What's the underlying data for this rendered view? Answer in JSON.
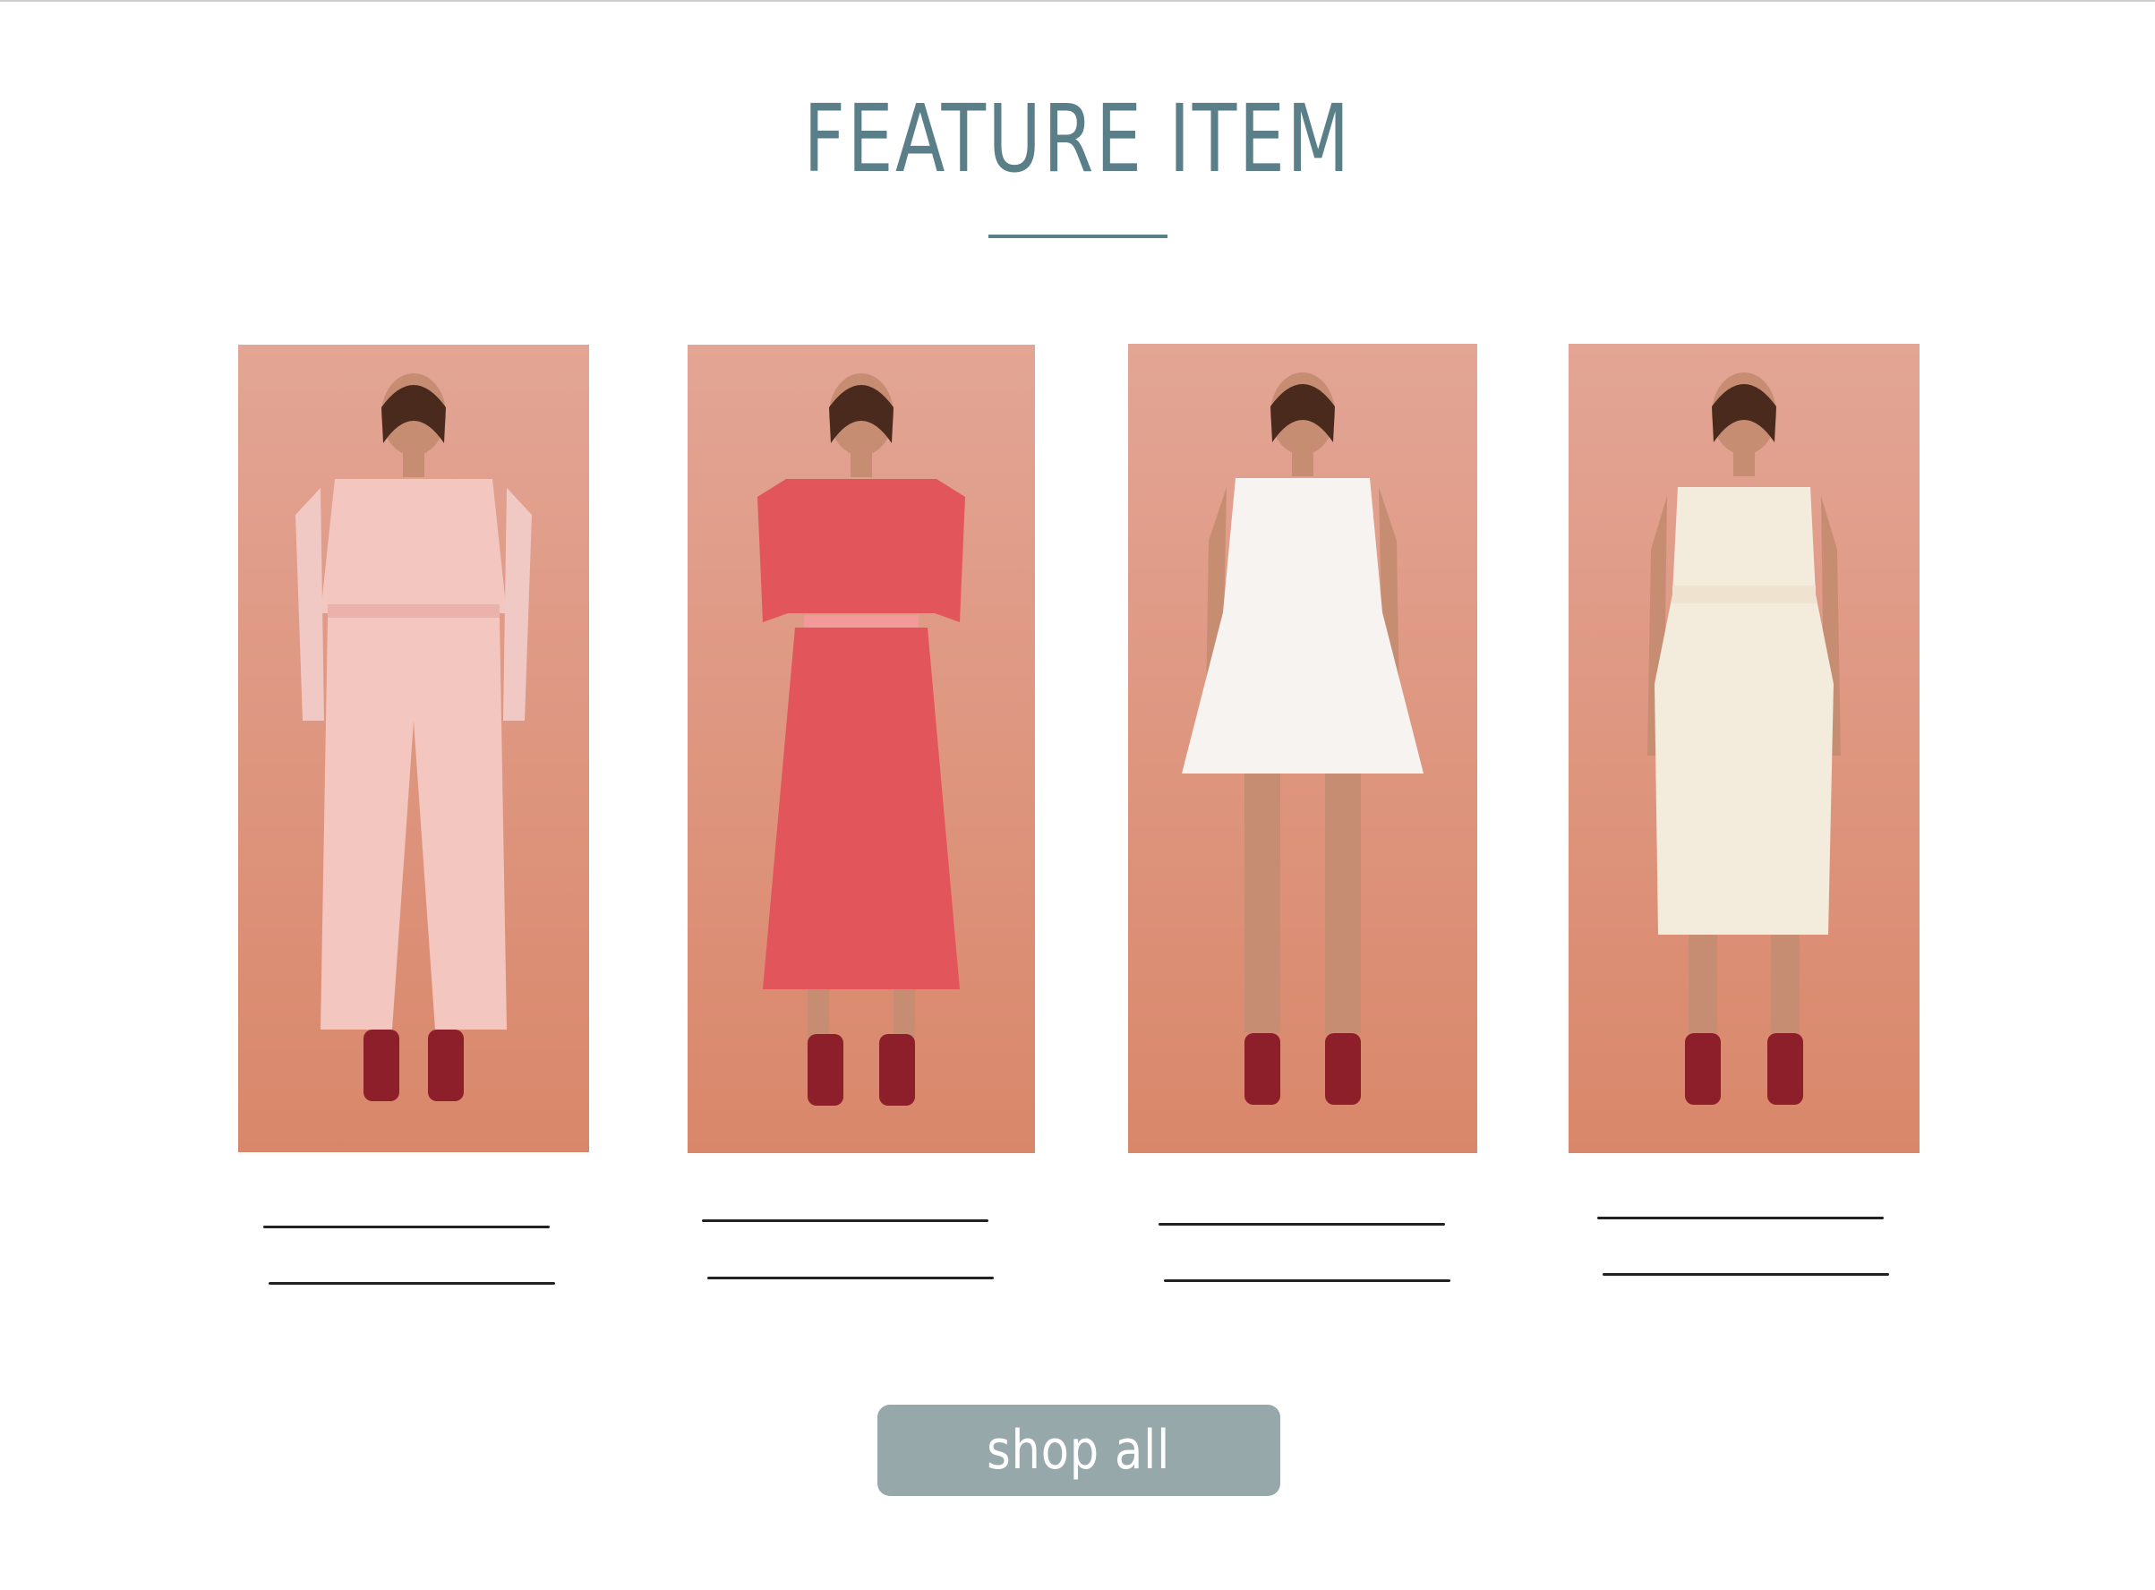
{
  "header": {
    "title": "FEATURE ITEM"
  },
  "products": [
    {
      "name": "",
      "price": "",
      "outfit": "pink blouse and wide-leg trousers",
      "outfit_color": "#f3c6bf"
    },
    {
      "name": "",
      "price": "",
      "outfit": "coral lace midi dress",
      "outfit_color": "#e2555b"
    },
    {
      "name": "",
      "price": "",
      "outfit": "white tiered mini dress",
      "outfit_color": "#f7f3f1"
    },
    {
      "name": "",
      "price": "",
      "outfit": "cream embroidered midi dress",
      "outfit_color": "#f3ebdc"
    }
  ],
  "cta": {
    "label": "shop all"
  },
  "colors": {
    "accent": "#5b7f88",
    "button_bg": "#97a8aa",
    "photo_backdrop": "#dd9077",
    "shoes": "#8c1f2a"
  }
}
